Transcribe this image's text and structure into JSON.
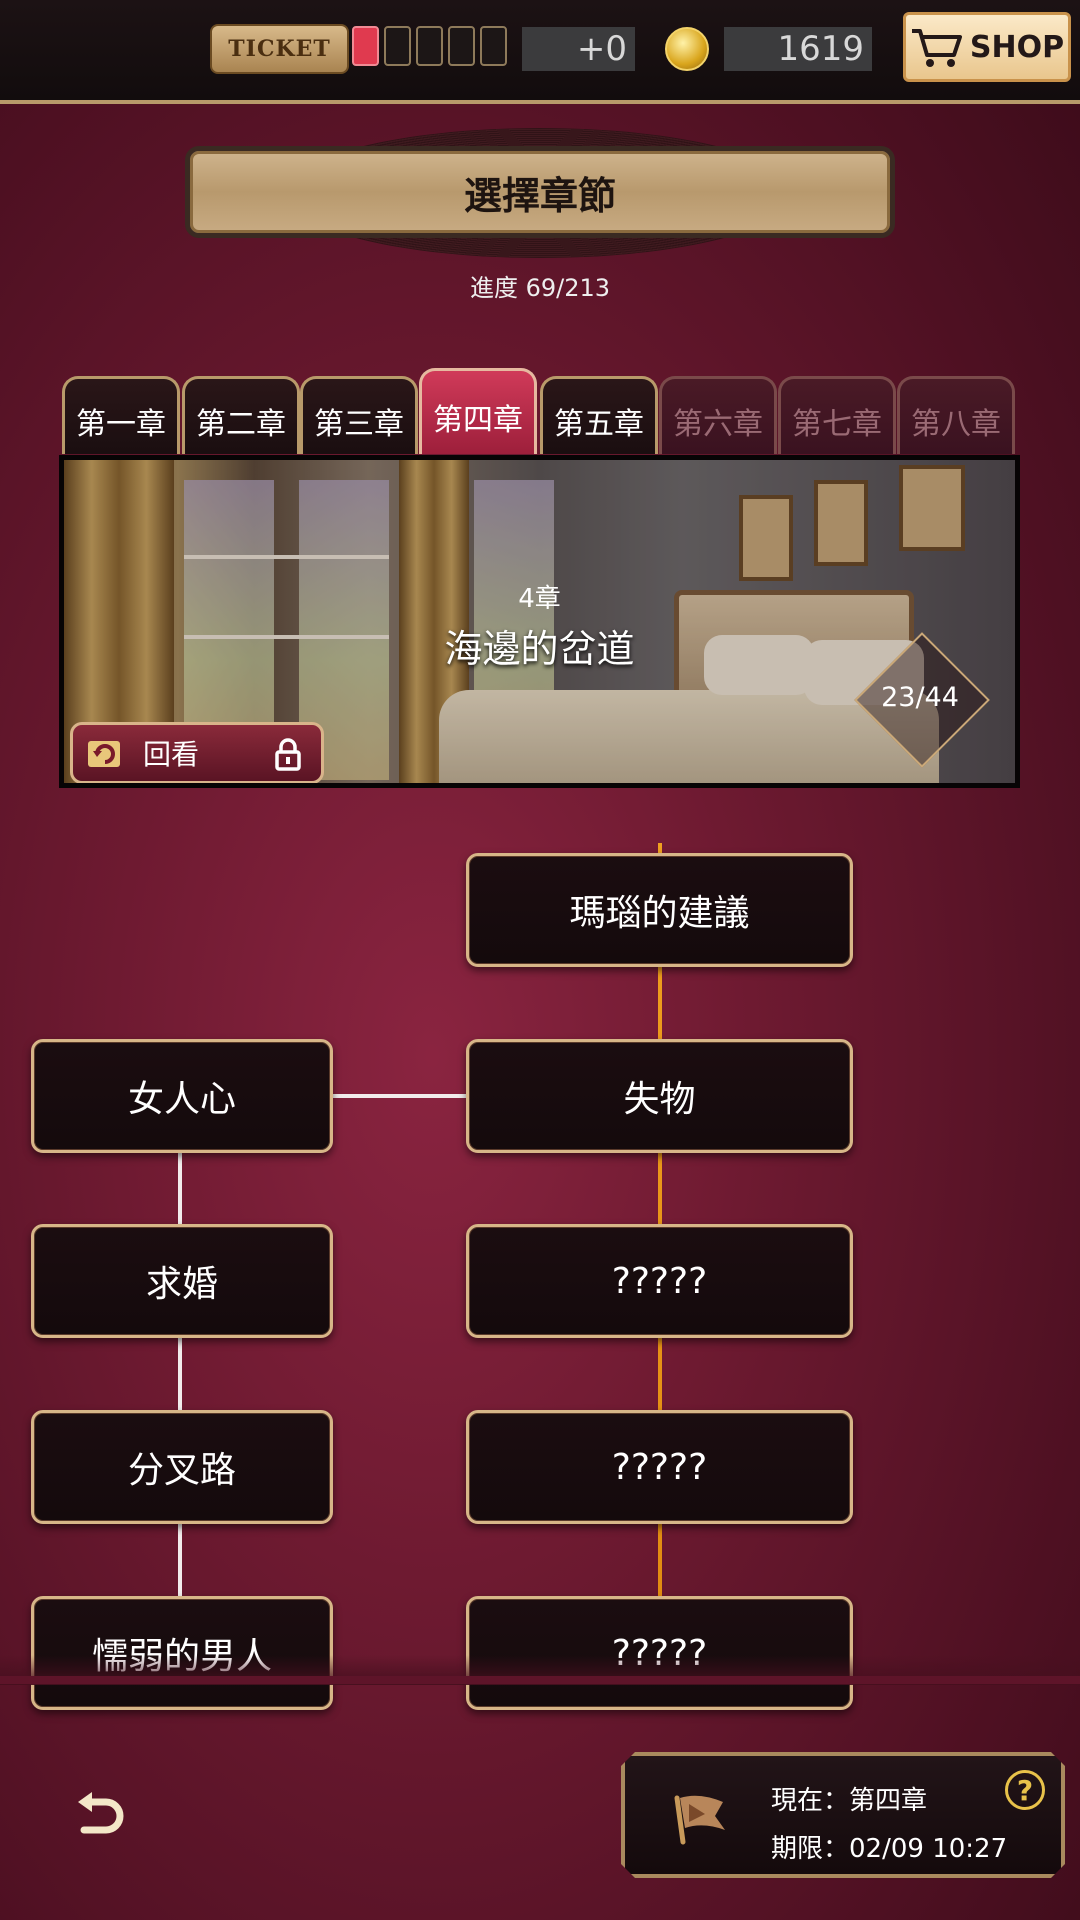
{
  "topbar": {
    "ticket_label": "TICKET",
    "ticket_slots_filled": 1,
    "ticket_slots_total": 5,
    "ticket_bonus": "+0",
    "coins": "1619",
    "shop_label": "SHOP"
  },
  "header": {
    "title": "選擇章節",
    "progress": "進度 69/213"
  },
  "tabs": [
    {
      "label": "第一章",
      "state": "normal"
    },
    {
      "label": "第二章",
      "state": "normal"
    },
    {
      "label": "第三章",
      "state": "normal"
    },
    {
      "label": "第四章",
      "state": "active"
    },
    {
      "label": "第五章",
      "state": "normal"
    },
    {
      "label": "第六章",
      "state": "locked"
    },
    {
      "label": "第七章",
      "state": "locked"
    },
    {
      "label": "第八章",
      "state": "locked"
    }
  ],
  "banner": {
    "chapter_number": "4章",
    "chapter_name": "海邊的岔道",
    "progress": "23/44",
    "replay_label": "回看"
  },
  "story_nodes": {
    "right": [
      "瑪瑙的建議",
      "失物",
      "?????",
      "?????",
      "?????"
    ],
    "left": [
      "女人心",
      "求婚",
      "分叉路",
      "懦弱的男人"
    ]
  },
  "status": {
    "current": "現在：第四章",
    "deadline": "期限：02/09 10:27",
    "help": "?"
  },
  "colors": {
    "accent_gold": "#d7b688",
    "active_tab": "#c8314f",
    "route_line": "#f0a020",
    "ticket_filled": "#e03a4f"
  }
}
